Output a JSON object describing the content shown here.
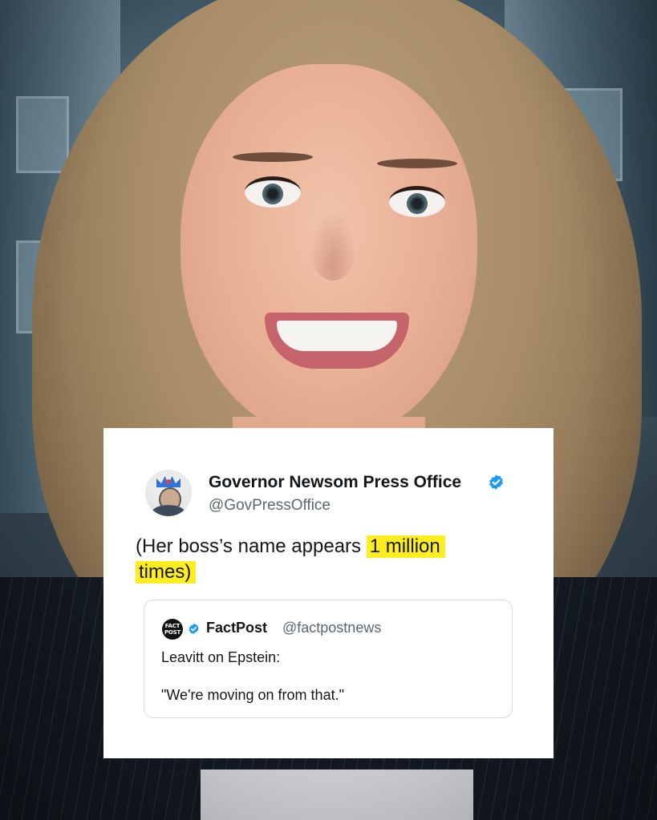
{
  "tweet": {
    "author_name": "Governor Newsom Press Office",
    "author_handle": "@GovPressOffice",
    "text_before_highlight": "(Her boss’s name appears ",
    "text_highlight_1": "1 million",
    "text_highlight_2": "times)",
    "highlight_color": "#ffee1f",
    "verified_color": "#1d9bf0"
  },
  "quoted_tweet": {
    "avatar_text": "FACT POST",
    "author_name": "FactPost",
    "author_handle": "@factpostnews",
    "line1": "Leavitt on Epstein:",
    "line2": "\"We're moving on from that.\""
  }
}
